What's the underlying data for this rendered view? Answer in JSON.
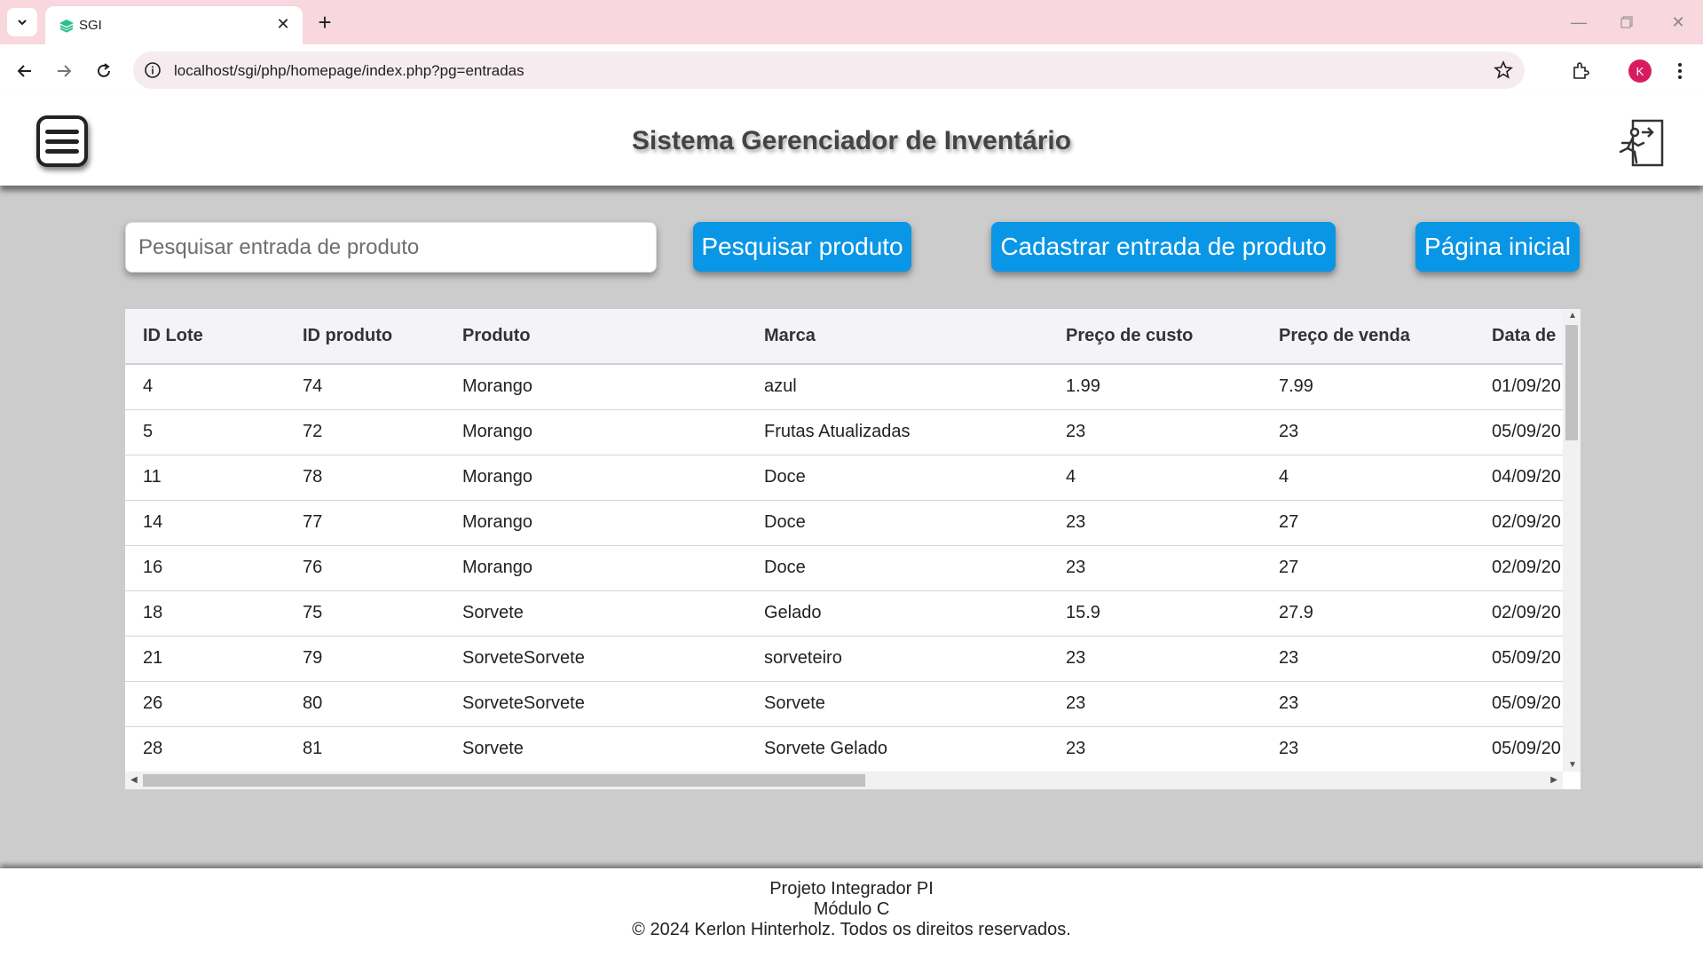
{
  "browser": {
    "tab_title": "SGI",
    "url": "localhost/sgi/php/homepage/index.php?pg=entradas",
    "profile_initial": "K"
  },
  "header": {
    "title": "Sistema Gerenciador de Inventário"
  },
  "controls": {
    "search_placeholder": "Pesquisar entrada de produto",
    "search_button": "Pesquisar produto",
    "register_button": "Cadastrar entrada de produto",
    "home_button": "Página inicial"
  },
  "table": {
    "columns": [
      "ID Lote",
      "ID produto",
      "Produto",
      "Marca",
      "Preço de custo",
      "Preço de venda",
      "Data de "
    ],
    "rows": [
      [
        "4",
        "74",
        "Morango",
        "azul",
        "1.99",
        "7.99",
        "01/09/20"
      ],
      [
        "5",
        "72",
        "Morango",
        "Frutas Atualizadas",
        "23",
        "23",
        "05/09/20"
      ],
      [
        "11",
        "78",
        "Morango",
        "Doce",
        "4",
        "4",
        "04/09/20"
      ],
      [
        "14",
        "77",
        "Morango",
        "Doce",
        "23",
        "27",
        "02/09/20"
      ],
      [
        "16",
        "76",
        "Morango",
        "Doce",
        "23",
        "27",
        "02/09/20"
      ],
      [
        "18",
        "75",
        "Sorvete",
        "Gelado",
        "15.9",
        "27.9",
        "02/09/20"
      ],
      [
        "21",
        "79",
        "SorveteSorvete",
        "sorveteiro",
        "23",
        "23",
        "05/09/20"
      ],
      [
        "26",
        "80",
        "SorveteSorvete",
        "Sorvete",
        "23",
        "23",
        "05/09/20"
      ],
      [
        "28",
        "81",
        "Sorvete",
        "Sorvete Gelado",
        "23",
        "23",
        "05/09/20"
      ]
    ]
  },
  "footer": {
    "line1": "Projeto Integrador PI",
    "line2": "Módulo C",
    "line3": "© 2024 Kerlon Hinterholz. Todos os direitos reservados."
  },
  "colors": {
    "accent": "#0a96e6",
    "tabbar": "#f8d7df",
    "background": "#cccccc"
  }
}
